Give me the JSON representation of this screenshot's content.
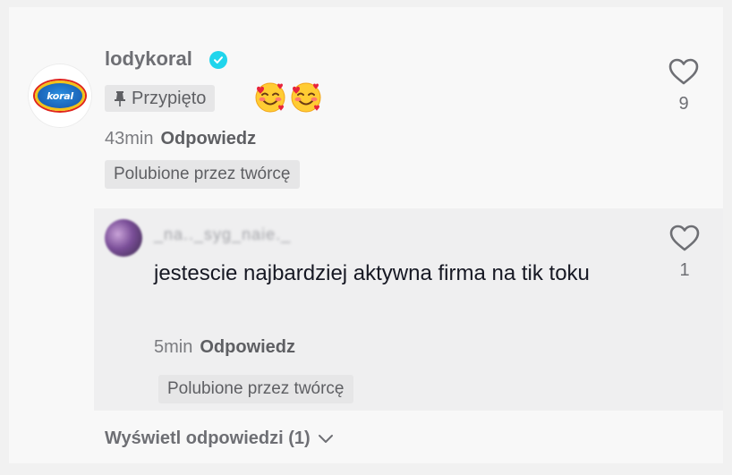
{
  "comment": {
    "username": "lodykoral",
    "pinned_label": "Przypięto",
    "time": "43min",
    "reply_label": "Odpowiedz",
    "liked_by_creator": "Polubione przez twórcę",
    "like_count": "9",
    "emojis": [
      "smiling-face-with-hearts",
      "smiling-face-with-hearts"
    ],
    "avatar_logo_text": "koral"
  },
  "reply": {
    "username": "_na.._syg_naie._",
    "text": "jestescie najbardziej aktywna firma na tik toku",
    "time": "5min",
    "reply_label": "Odpowiedz",
    "liked_by_creator": "Polubione przez twórcę",
    "like_count": "1"
  },
  "view_replies_label": "Wyświetl odpowiedzi (1)",
  "colors": {
    "verified": "#20d5ec",
    "background": "#f8f8f8",
    "reply_background": "#efeff0",
    "tag_background": "#e6e6e7"
  }
}
